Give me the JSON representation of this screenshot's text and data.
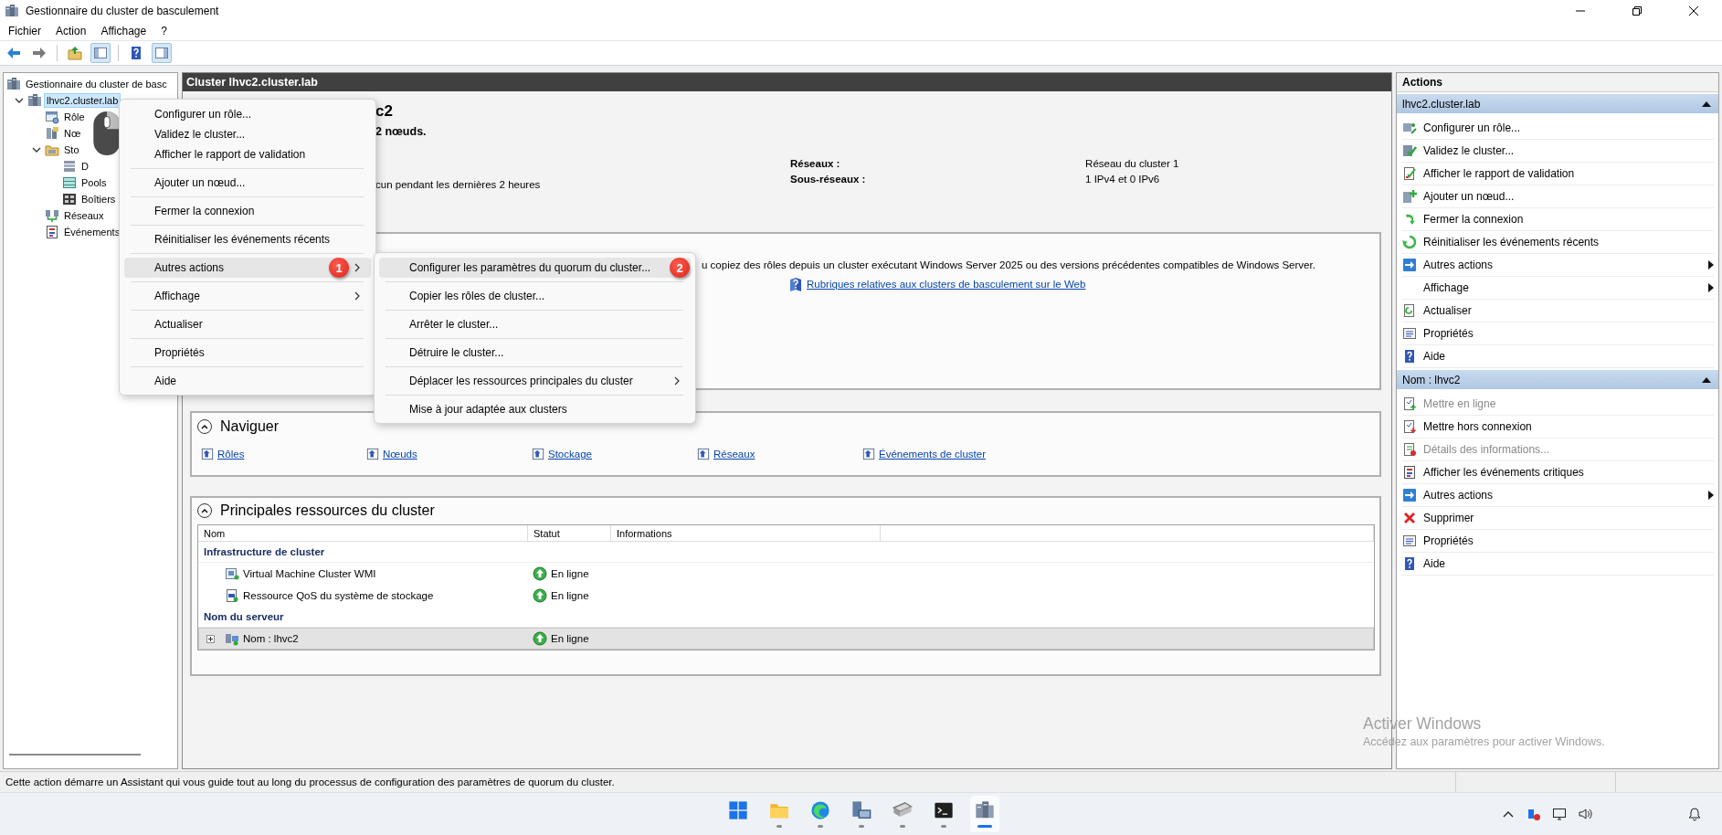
{
  "window": {
    "title": "Gestionnaire du cluster de basculement"
  },
  "menu_bar": [
    "Fichier",
    "Action",
    "Affichage",
    "?"
  ],
  "tree": [
    {
      "label": "Gestionnaire du cluster de basc",
      "selected": false,
      "children": [
        {
          "label": "lhvc2.cluster.lab",
          "selected": true,
          "expanded": true,
          "children": [
            {
              "label": "Rôle",
              "selected": false
            },
            {
              "label": "Nœ",
              "selected": false
            },
            {
              "label": "Sto",
              "selected": false,
              "expanded": true,
              "children": [
                {
                  "label": "D",
                  "selected": false
                },
                {
                  "label": "Pools",
                  "selected": false
                },
                {
                  "label": "Boîtiers",
                  "selected": false
                }
              ]
            },
            {
              "label": "Réseaux",
              "selected": false
            },
            {
              "label": "Événements",
              "selected": false
            }
          ]
        }
      ]
    }
  ],
  "center": {
    "header": "Cluster lhvc2.cluster.lab",
    "summary": {
      "heading": "c2",
      "nodes": "2 nœuds.",
      "events": "cun pendant les dernières 2 heures",
      "facts": [
        {
          "label": "Réseaux :",
          "value": "Réseau du cluster 1"
        },
        {
          "label": "Sous-réseaux :",
          "value": "1 IPv4 et 0 IPv6"
        }
      ]
    },
    "info_box": {
      "text": "u copiez des rôles depuis un cluster exécutant Windows Server 2025 ou des versions précédentes compatibles de Windows Server.",
      "link": "Rubriques relatives aux clusters de basculement sur le Web"
    },
    "navigate": {
      "title": "Naviguer",
      "expanded": true,
      "links": [
        "Rôles",
        "Nœuds",
        "Stockage",
        "Réseaux",
        "Événements de cluster"
      ]
    },
    "resources": {
      "title": "Principales ressources du cluster",
      "expanded": true,
      "columns": [
        "Nom",
        "Statut",
        "Informations"
      ],
      "groups": [
        {
          "title": "Infrastructure de cluster",
          "rows": [
            {
              "name": "Virtual Machine Cluster WMI",
              "status": "En ligne",
              "selected": false
            },
            {
              "name": "Ressource QoS du système de stockage",
              "status": "En ligne",
              "selected": false
            }
          ]
        },
        {
          "title": "Nom du serveur",
          "rows": [
            {
              "name": "Nom : lhvc2",
              "status": "En ligne",
              "selected": true,
              "expanded": false
            }
          ]
        }
      ]
    }
  },
  "actions": {
    "title": "Actions",
    "sections": [
      {
        "title": "lhvc2.cluster.lab",
        "expanded": true,
        "items": [
          {
            "label": "Configurer un rôle...",
            "disabled": false,
            "has_submenu": false
          },
          {
            "label": "Validez le cluster...",
            "disabled": false,
            "has_submenu": false
          },
          {
            "label": "Afficher le rapport de validation",
            "disabled": false,
            "has_submenu": false
          },
          {
            "label": "Ajouter un nœud...",
            "disabled": false,
            "has_submenu": false
          },
          {
            "label": "Fermer la connexion",
            "disabled": false,
            "has_submenu": false
          },
          {
            "label": "Réinitialiser les événements récents",
            "disabled": false,
            "has_submenu": false
          },
          {
            "label": "Autres actions",
            "disabled": false,
            "has_submenu": true
          },
          {
            "label": "Affichage",
            "disabled": false,
            "has_submenu": true
          },
          {
            "label": "Actualiser",
            "disabled": false,
            "has_submenu": false
          },
          {
            "label": "Propriétés",
            "disabled": false,
            "has_submenu": false
          },
          {
            "label": "Aide",
            "disabled": false,
            "has_submenu": false
          }
        ]
      },
      {
        "title": "Nom : lhvc2",
        "expanded": true,
        "items": [
          {
            "label": "Mettre en ligne",
            "disabled": true,
            "has_submenu": false
          },
          {
            "label": "Mettre hors connexion",
            "disabled": false,
            "has_submenu": false
          },
          {
            "label": "Détails des informations...",
            "disabled": true,
            "has_submenu": false
          },
          {
            "label": "Afficher les événements critiques",
            "disabled": false,
            "has_submenu": false
          },
          {
            "label": "Autres actions",
            "disabled": false,
            "has_submenu": true
          },
          {
            "label": "Supprimer",
            "disabled": false,
            "has_submenu": false
          },
          {
            "label": "Propriétés",
            "disabled": false,
            "has_submenu": false
          },
          {
            "label": "Aide",
            "disabled": false,
            "has_submenu": false
          }
        ]
      }
    ]
  },
  "context_menu": {
    "groups": [
      [
        {
          "label": "Configurer un rôle...",
          "selected": false,
          "has_submenu": false
        },
        {
          "label": "Validez le cluster...",
          "selected": false,
          "has_submenu": false
        },
        {
          "label": "Afficher le rapport de validation",
          "selected": false,
          "has_submenu": false
        }
      ],
      [
        {
          "label": "Ajouter un nœud...",
          "selected": false,
          "has_submenu": false
        }
      ],
      [
        {
          "label": "Fermer la connexion",
          "selected": false,
          "has_submenu": false
        }
      ],
      [
        {
          "label": "Réinitialiser les événements récents",
          "selected": false,
          "has_submenu": false
        }
      ],
      [
        {
          "label": "Autres actions",
          "selected": true,
          "has_submenu": true,
          "badge": "1"
        }
      ],
      [
        {
          "label": "Affichage",
          "selected": false,
          "has_submenu": true
        }
      ],
      [
        {
          "label": "Actualiser",
          "selected": false,
          "has_submenu": false
        }
      ],
      [
        {
          "label": "Propriétés",
          "selected": false,
          "has_submenu": false
        }
      ],
      [
        {
          "label": "Aide",
          "selected": false,
          "has_submenu": false
        }
      ]
    ]
  },
  "submenu": {
    "items": [
      {
        "label": "Configurer les paramètres du quorum du cluster...",
        "selected": true,
        "has_submenu": false,
        "badge": "2"
      },
      {
        "label": "Copier les rôles de cluster...",
        "selected": false,
        "has_submenu": false
      },
      {
        "label": "Arrêter le cluster...",
        "selected": false,
        "has_submenu": false
      },
      {
        "label": "Détruire le cluster...",
        "selected": false,
        "has_submenu": false
      },
      {
        "label": "Déplacer les ressources principales du cluster",
        "selected": false,
        "has_submenu": true
      },
      {
        "label": "Mise à jour adaptée aux clusters",
        "selected": false,
        "has_submenu": false
      }
    ]
  },
  "status_bar": "Cette action démarre un Assistant qui vous guide tout au long du processus de configuration des paramètres de quorum du cluster.",
  "activation_notice": {
    "title": "Activer Windows",
    "text": "Accédez aux paramètres pour activer Windows."
  },
  "taskbar": {
    "apps": [
      {
        "running": false,
        "active": false
      },
      {
        "running": true,
        "active": false
      },
      {
        "running": true,
        "active": false
      },
      {
        "running": true,
        "active": false
      },
      {
        "running": true,
        "active": false
      },
      {
        "running": true,
        "active": false
      },
      {
        "running": true,
        "active": true
      }
    ]
  }
}
